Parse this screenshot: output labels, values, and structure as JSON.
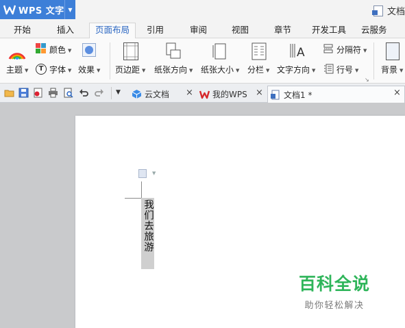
{
  "app": {
    "name": "WPS 文字",
    "doc_title": "文档"
  },
  "menu": {
    "tabs": [
      "开始",
      "插入",
      "页面布局",
      "引用",
      "审阅",
      "视图",
      "章节",
      "开发工具",
      "云服务"
    ],
    "active": "页面布局"
  },
  "ribbon": {
    "theme": "主题",
    "color": "颜色",
    "font": "字体",
    "effect": "效果",
    "margins": "页边距",
    "orientation": "纸张方向",
    "size": "纸张大小",
    "columns": "分栏",
    "text_direction": "文字方向",
    "breaks": "分隔符",
    "line_numbers": "行号",
    "background": "背景"
  },
  "doc_tabs": [
    {
      "label": "云文档"
    },
    {
      "label": "我的WPS"
    },
    {
      "label": "文档1 *"
    }
  ],
  "document": {
    "vertical_text": "我们去旅游"
  },
  "watermark": {
    "main": "百科全说",
    "sub": "助你轻松解决"
  },
  "colors": {
    "accent": "#3d7fd8",
    "watermark_green": "#2fb55a"
  }
}
